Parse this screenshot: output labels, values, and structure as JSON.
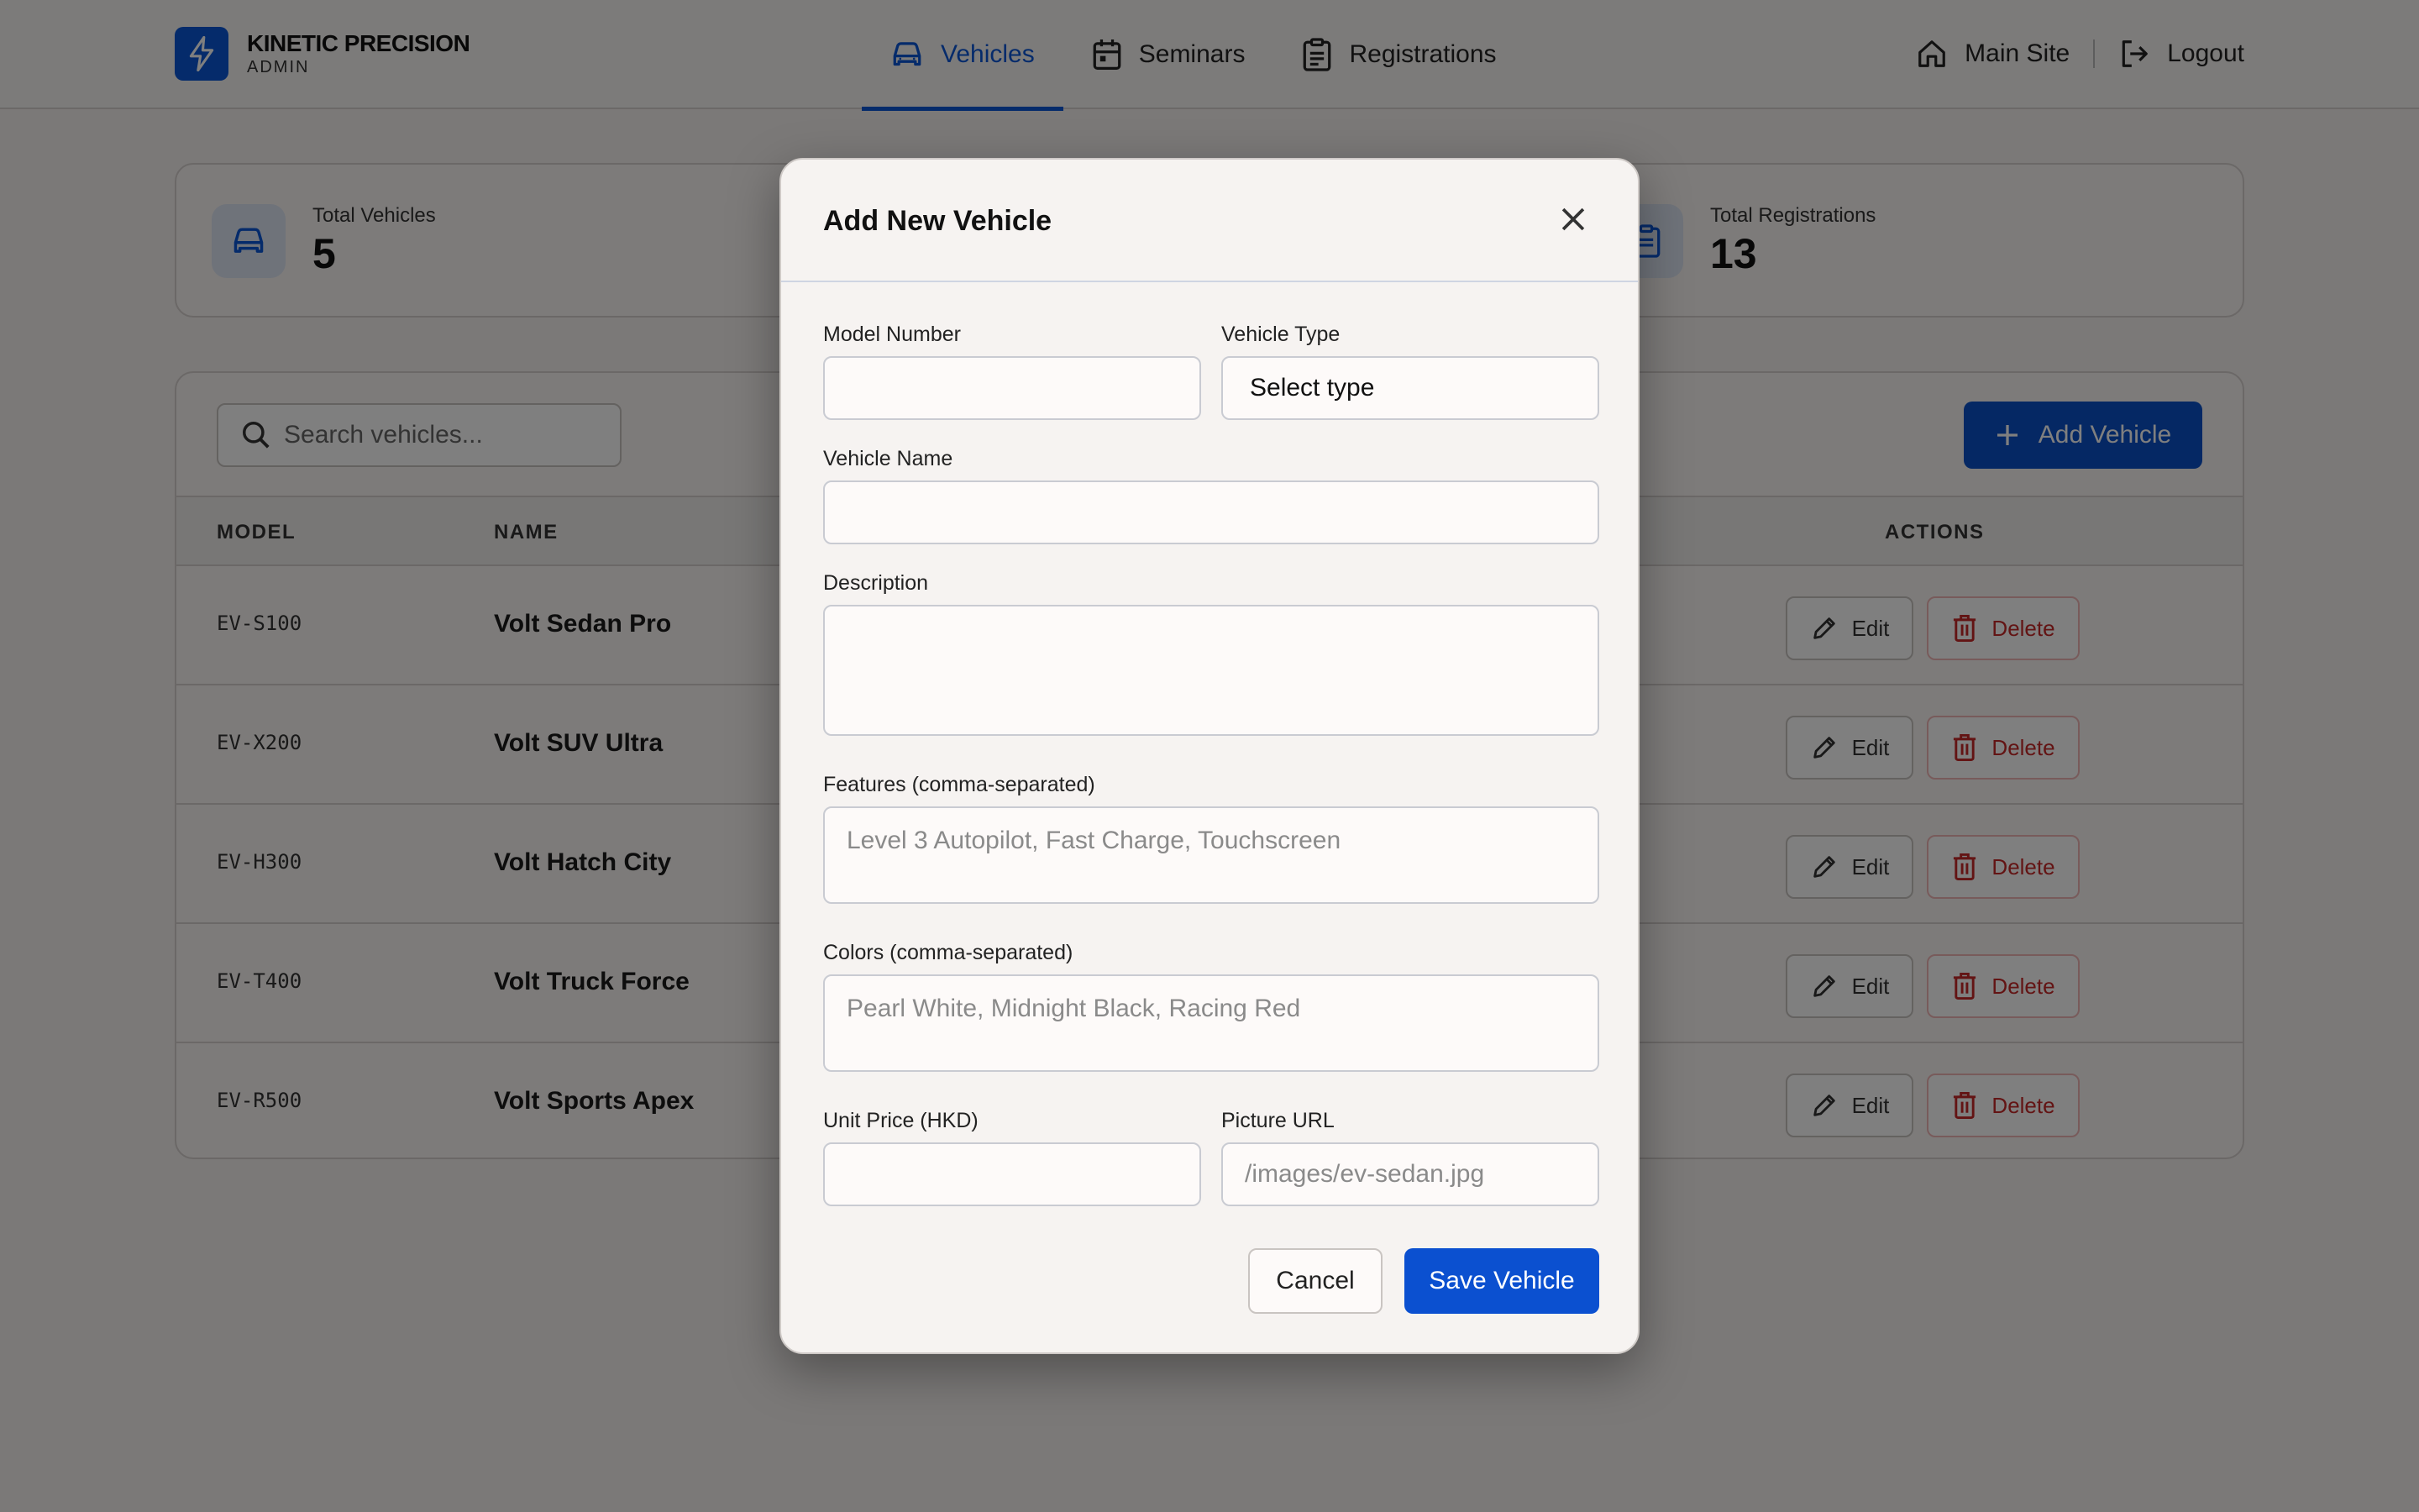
{
  "brand": {
    "title": "KINETIC PRECISION",
    "subtitle": "ADMIN"
  },
  "nav": [
    {
      "label": "Vehicles",
      "icon": "car-icon",
      "active": true
    },
    {
      "label": "Seminars",
      "icon": "calendar-icon",
      "active": false
    },
    {
      "label": "Registrations",
      "icon": "clipboard-icon",
      "active": false
    }
  ],
  "header_right": {
    "main_site": "Main Site",
    "logout": "Logout"
  },
  "stats": [
    {
      "label": "Total Vehicles",
      "value": "5",
      "icon": "car-icon"
    },
    {
      "label": "Total Registrations",
      "value": "13",
      "icon": "clipboard-icon"
    }
  ],
  "table": {
    "search_placeholder": "Search vehicles...",
    "add_label": "Add Vehicle",
    "columns": {
      "model": "MODEL",
      "name": "NAME",
      "actions": "ACTIONS"
    },
    "edit_label": "Edit",
    "delete_label": "Delete",
    "rows": [
      {
        "model": "EV-S100",
        "name": "Volt Sedan Pro"
      },
      {
        "model": "EV-X200",
        "name": "Volt SUV Ultra"
      },
      {
        "model": "EV-H300",
        "name": "Volt Hatch City"
      },
      {
        "model": "EV-T400",
        "name": "Volt Truck Force"
      },
      {
        "model": "EV-R500",
        "name": "Volt Sports Apex"
      }
    ]
  },
  "modal": {
    "title": "Add New Vehicle",
    "model_number_label": "Model Number",
    "model_number_value": "",
    "vehicle_type_label": "Vehicle Type",
    "vehicle_type_value": "Select type",
    "vehicle_name_label": "Vehicle Name",
    "vehicle_name_value": "",
    "description_label": "Description",
    "description_value": "",
    "features_label": "Features (comma-separated)",
    "features_placeholder": "Level 3 Autopilot, Fast Charge, Touchscreen",
    "colors_label": "Colors (comma-separated)",
    "colors_placeholder": "Pearl White, Midnight Black, Racing Red",
    "price_label": "Unit Price (HKD)",
    "price_value": "",
    "picture_label": "Picture URL",
    "picture_placeholder": "/images/ev-sedan.jpg",
    "cancel_label": "Cancel",
    "save_label": "Save Vehicle"
  },
  "colors": {
    "accent": "#0b56d6",
    "danger": "#c62828"
  }
}
